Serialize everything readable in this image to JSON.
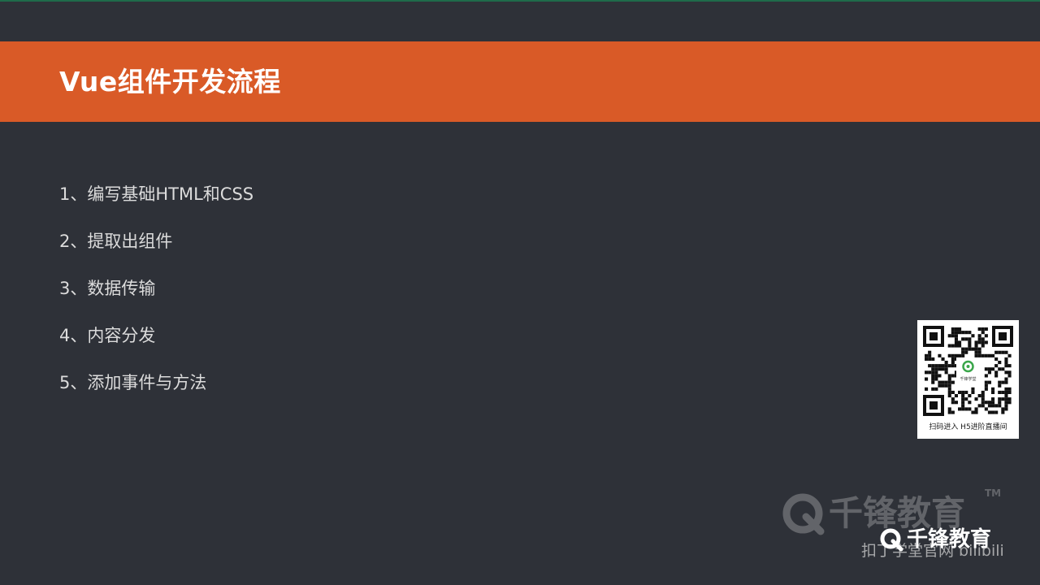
{
  "slide": {
    "title": "Vue组件开发流程",
    "steps": [
      "1、编写基础HTML和CSS",
      "2、提取出组件",
      "3、数据传输",
      "4、内容分发",
      "5、添加事件与方法"
    ]
  },
  "qr": {
    "icon": "qr-code-icon",
    "center_label": "千锋学堂",
    "caption": "扫码进入 H5进阶直播间"
  },
  "watermark": {
    "logo_text": "千锋教育",
    "trademark": "TM",
    "bottom_text": "扣丁学堂官网 bilibili",
    "bottom_logo_text": "千锋教育"
  },
  "colors": {
    "background": "#2e3138",
    "title_bar": "#d95a27",
    "title_text": "#ffffff",
    "body_text": "#dcdcdc"
  }
}
